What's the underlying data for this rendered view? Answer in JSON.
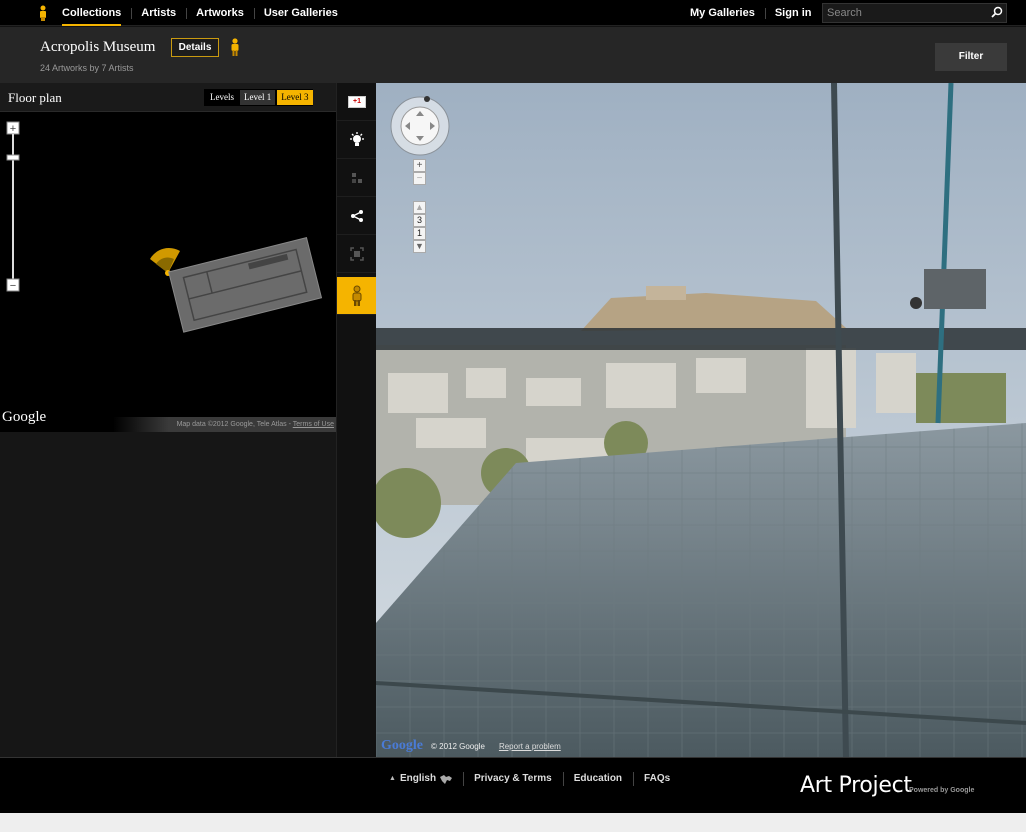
{
  "topbar": {
    "nav": [
      "Collections",
      "Artists",
      "Artworks",
      "User Galleries"
    ],
    "active_nav": "Collections",
    "right_nav": [
      "My Galleries",
      "Sign in"
    ],
    "search_placeholder": "Search"
  },
  "header": {
    "title": "Acropolis Museum",
    "details_label": "Details",
    "subtitle": "24 Artworks by 7 Artists",
    "filter_label": "Filter"
  },
  "floorplan": {
    "title": "Floor plan",
    "levels_label": "Levels",
    "levels": [
      "Level 1",
      "Level 3"
    ],
    "active_level": "Level 3",
    "zoom_in": "+",
    "zoom_out": "−",
    "google_logo": "Google",
    "map_data": "Map data ©2012 Google, Tele Atlas - ",
    "terms": "Terms of Use"
  },
  "tools": {
    "gplus_label": "+1"
  },
  "streetview": {
    "zoom_in": "+",
    "zoom_out": "−",
    "floor_buttons": [
      "3",
      "1"
    ],
    "google_logo": "Google",
    "copyright": "© 2012 Google",
    "report": "Report a problem"
  },
  "footer": {
    "language": "English",
    "links": [
      "Privacy & Terms",
      "Education",
      "FAQs"
    ],
    "brand": "Art Project",
    "powered": "Powered by Google"
  },
  "colors": {
    "accent": "#f5b400",
    "background": "#121212",
    "header": "#262626"
  }
}
